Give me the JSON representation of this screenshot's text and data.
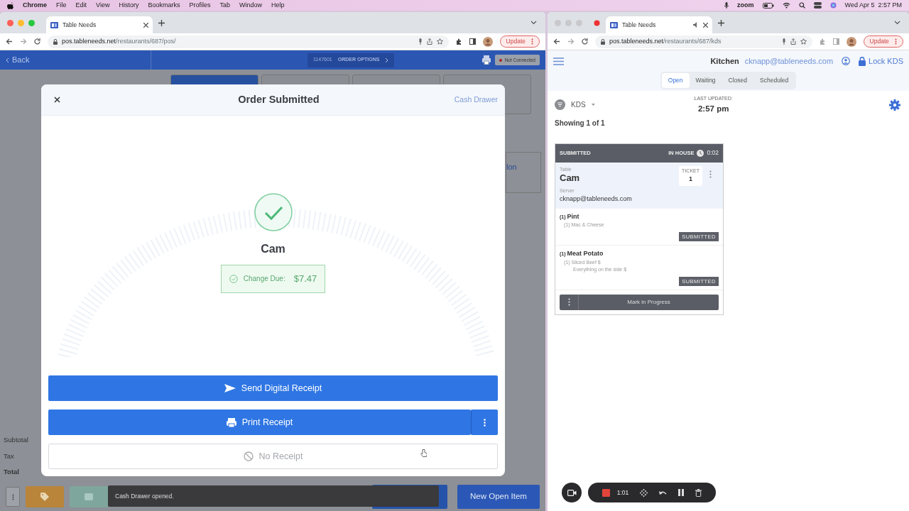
{
  "menubar": {
    "app": "Chrome",
    "menus": [
      "File",
      "Edit",
      "View",
      "History",
      "Bookmarks",
      "Profiles",
      "Tab",
      "Window",
      "Help"
    ],
    "zoom_label": "zoom",
    "clock": "Wed Apr 5  2:57 PM"
  },
  "pos_window": {
    "tab_title": "Table Needs",
    "url_host": "pos.tableneeds.net",
    "url_path": "/restaurants/687/pos/",
    "update": "Update",
    "app": {
      "back": "Back",
      "order_number": "1147601",
      "order_options": "ORDER OPTIONS",
      "printer_status": "Not Connected",
      "side_text": "lon",
      "totals": [
        "Subtotal",
        "Tax",
        "Total"
      ],
      "category_tabs": [
        {
          "selected": true
        },
        {
          "selected": false
        },
        {
          "selected": false
        },
        {
          "selected": false
        }
      ],
      "new_open_item": "New Open Item"
    },
    "modal": {
      "title": "Order Submitted",
      "cash_drawer": "Cash Drawer",
      "customer": "Cam",
      "change_label": "Change Due:",
      "change_amount": "$7.47",
      "buttons": [
        {
          "label": "Send Digital Receipt",
          "kind": "primary"
        },
        {
          "label": "Print Receipt",
          "kind": "split"
        },
        {
          "label": "No Receipt",
          "kind": "outline"
        }
      ]
    },
    "toast": "Cash Drawer opened."
  },
  "kds_window": {
    "tab_title": "Table Needs",
    "url_host": "pos.tableneeds.net",
    "url_path": "/restaurants/687/kds",
    "update": "Update",
    "station": "Kitchen",
    "user": "cknapp@tableneeds.com",
    "lock": "Lock KDS",
    "tabs": [
      {
        "label": "Open",
        "selected": true
      },
      {
        "label": "Waiting",
        "selected": false
      },
      {
        "label": "Closed",
        "selected": false
      },
      {
        "label": "Scheduled",
        "selected": false
      }
    ],
    "filter": "KDS",
    "last_updated_label": "LAST UPDATED:",
    "last_updated": "2:57 pm",
    "showing": "Showing 1 of 1",
    "ticket": {
      "status": "SUBMITTED",
      "order_type": "IN HOUSE",
      "timer": "0:02",
      "table_label": "Table",
      "table": "Cam",
      "ticket_label": "TICKET",
      "ticket_number": "1",
      "server_label": "Server",
      "server": "cknapp@tableneeds.com",
      "items": [
        {
          "qty": "(1)",
          "name": "Pint",
          "modifiers": [
            "(1) Mac & Cheese"
          ],
          "status": "SUBMITTED"
        },
        {
          "qty": "(1)",
          "name": "Meat Potato",
          "modifiers": [
            "(1) Sliced Beef $",
            "Everything on the side $"
          ],
          "status": "SUBMITTED"
        }
      ],
      "action": "Mark in Progress"
    }
  },
  "recorder": {
    "time": "1:01"
  }
}
